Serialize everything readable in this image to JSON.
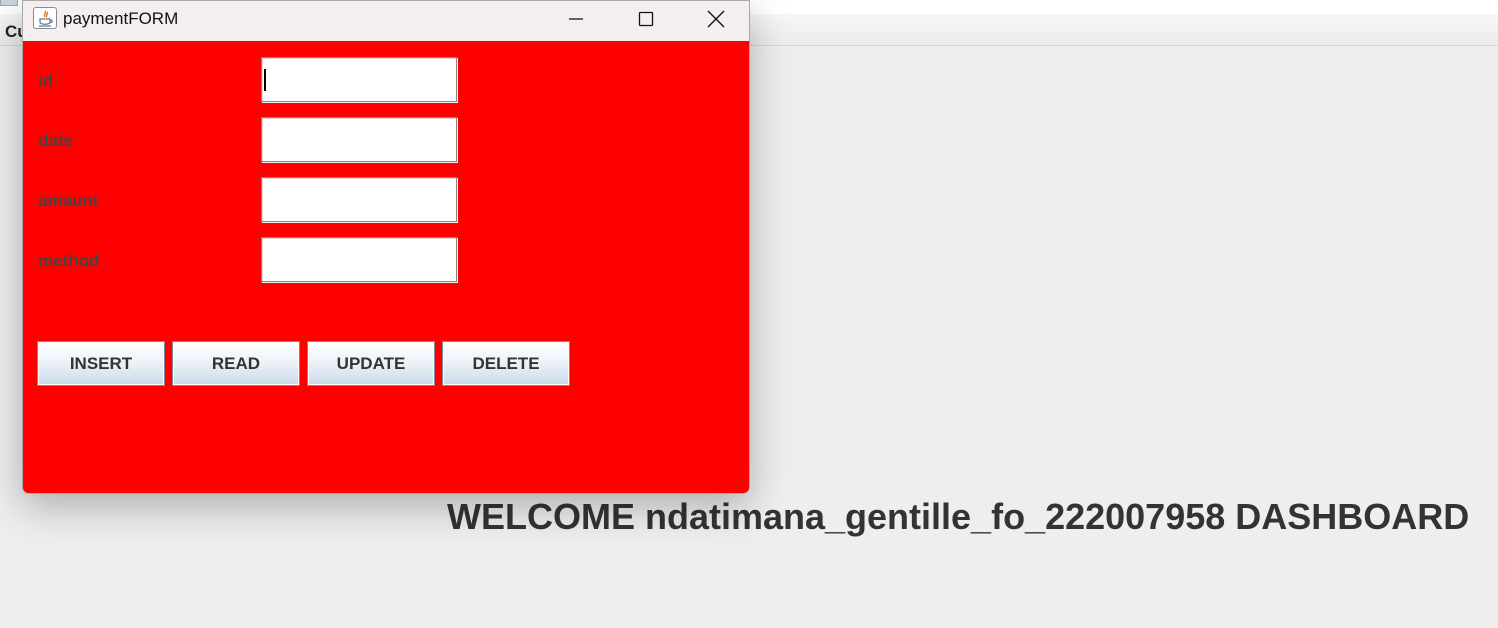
{
  "background_window": {
    "menu_item": "Cu",
    "welcome_text": "WELCOME ndatimana_gentille_fo_222007958 DASHBOARD"
  },
  "payment_window": {
    "title": "paymentFORM",
    "controls": {
      "minimize": "minimize-icon",
      "maximize": "maximize-icon",
      "close": "close-icon"
    },
    "fields": [
      {
        "label": "id",
        "value": "",
        "placeholder": ""
      },
      {
        "label": "date",
        "value": "",
        "placeholder": ""
      },
      {
        "label": "amaunt",
        "value": "",
        "placeholder": ""
      },
      {
        "label": "method",
        "value": "",
        "placeholder": ""
      }
    ],
    "buttons": [
      "INSERT",
      "READ",
      "UPDATE",
      "DELETE"
    ],
    "colors": {
      "form_background": "#ff0000",
      "title_bar": "#f4efee",
      "label_text": "#444444"
    }
  }
}
